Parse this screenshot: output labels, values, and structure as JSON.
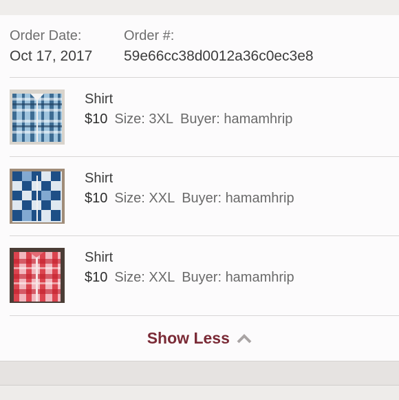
{
  "order": {
    "date_label": "Order Date:",
    "date_value": "Oct 17, 2017",
    "number_label": "Order #:",
    "number_value": "59e66cc38d0012a36c0ec3e8"
  },
  "items": [
    {
      "name": "Shirt",
      "price": "$10",
      "size": "Size: 3XL",
      "buyer": "Buyer: hamamhrip"
    },
    {
      "name": "Shirt",
      "price": "$10",
      "size": "Size: XXL",
      "buyer": "Buyer: hamamhrip"
    },
    {
      "name": "Shirt",
      "price": "$10",
      "size": "Size: XXL",
      "buyer": "Buyer: hamamhrip"
    }
  ],
  "footer": {
    "show_less": "Show Less",
    "chevron_icon": "chevron-up-icon"
  },
  "colors": {
    "accent": "#7a2a36",
    "card": "#fcfbfc",
    "background": "#eeecea"
  }
}
